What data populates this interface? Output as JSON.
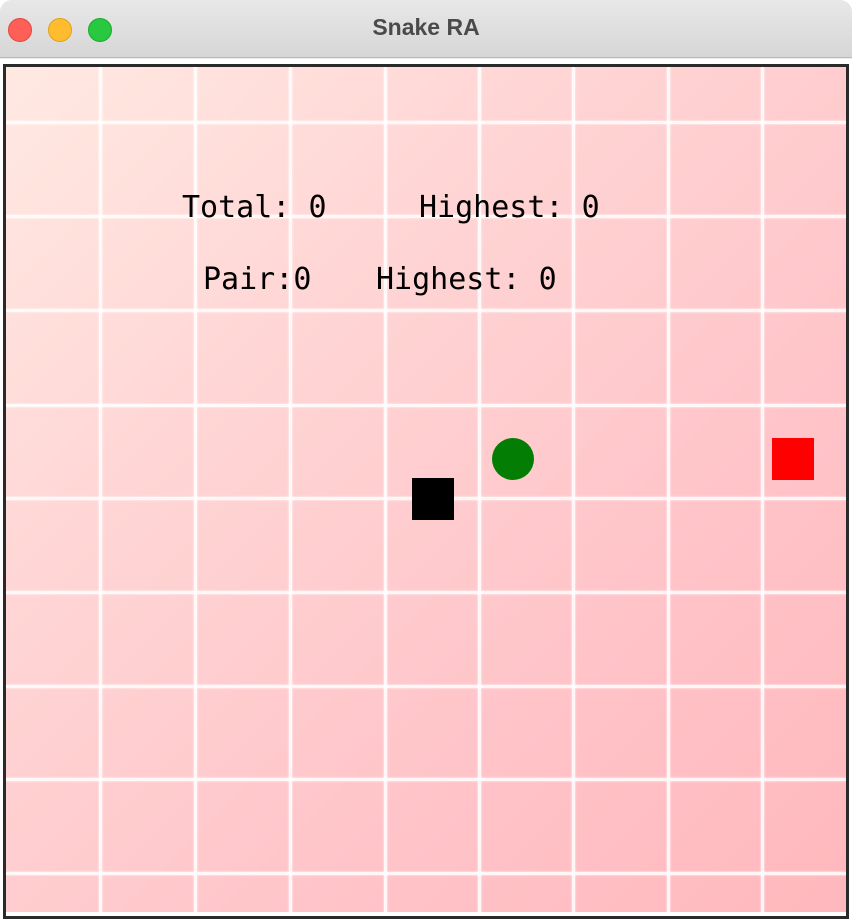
{
  "window": {
    "title": "Snake RA"
  },
  "scores": {
    "total_label": "Total:",
    "total_value": "0",
    "total_highest_label": "Highest:",
    "total_highest_value": "0",
    "pair_label": "Pair:",
    "pair_value": "0",
    "pair_highest_label": "Highest:",
    "pair_highest_value": "0"
  },
  "pieces": {
    "snake_head_color": "#000000",
    "partner_color": "#037d03",
    "food_color": "#ff0000"
  },
  "board": {
    "background_color": "#ffc8cc",
    "grid_color": "#ffffff"
  }
}
